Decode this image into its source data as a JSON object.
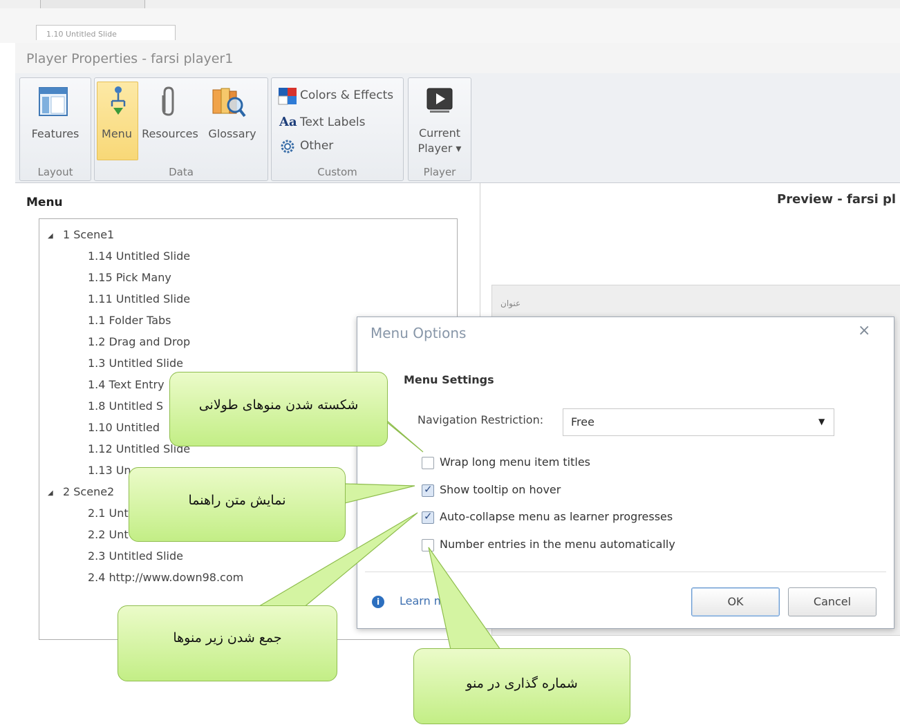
{
  "background": {
    "tab_label": "1.10 Untitled Slide"
  },
  "window": {
    "title": "Player Properties - farsi player1"
  },
  "ribbon": {
    "groups": [
      {
        "caption": "Layout",
        "buttons": [
          {
            "label": "Features",
            "icon": "features-icon"
          }
        ]
      },
      {
        "caption": "Data",
        "buttons": [
          {
            "label": "Menu",
            "icon": "menu-tree-icon",
            "selected": true
          },
          {
            "label": "Resources",
            "icon": "paperclip-icon"
          },
          {
            "label": "Glossary",
            "icon": "glossary-icon"
          }
        ]
      },
      {
        "caption": "Custom",
        "buttons": [
          {
            "label": "Colors & Effects",
            "icon": "color-palette-icon"
          },
          {
            "label": "Text Labels",
            "icon": "text-labels-icon"
          },
          {
            "label": "Other",
            "icon": "gear-icon"
          }
        ]
      },
      {
        "caption": "Player",
        "buttons": [
          {
            "label": "Current Player",
            "label_line1": "Current",
            "label_line2": "Player ▾",
            "icon": "player-icon"
          }
        ]
      }
    ]
  },
  "menu_panel": {
    "heading": "Menu",
    "tree": [
      {
        "label": "1  Scene1",
        "expanded": true,
        "children": [
          "1.14 Untitled Slide",
          "1.15 Pick Many",
          "1.11 Untitled Slide",
          "1.1 Folder Tabs",
          "1.2 Drag and Drop",
          "1.3 Untitled Slide",
          "1.4 Text Entry",
          "1.8 Untitled S",
          "1.10 Untitled",
          "1.12 Untitled Slide",
          "1.13 Un"
        ]
      },
      {
        "label": "2 Scene2",
        "expanded": true,
        "children": [
          "2.1 Unt",
          "2.2 Unt",
          "2.3 Untitled Slide",
          "2.4 http://www.down98.com"
        ]
      }
    ]
  },
  "preview": {
    "title": "Preview - farsi pl",
    "content_text": "عنوان"
  },
  "dialog": {
    "title": "Menu Options",
    "close_glyph": "×",
    "section_title": "Menu Settings",
    "navigation_restriction": {
      "label": "Navigation Restriction:",
      "value": "Free"
    },
    "options": [
      {
        "label": "Wrap long menu item titles",
        "checked": false
      },
      {
        "label": "Show tooltip on hover",
        "checked": true
      },
      {
        "label": "Auto-collapse menu as learner progresses",
        "checked": true
      },
      {
        "label": "Number entries in the menu automatically",
        "checked": false
      }
    ],
    "learn_more": "Learn m...",
    "ok_label": "OK",
    "cancel_label": "Cancel"
  },
  "callouts": {
    "wrap": "شکسته شدن منوهای طولانی",
    "tooltip": "نمایش متن راهنما",
    "collapse": "جمع شدن زیر منوها",
    "number": "شماره گذاری در منو"
  },
  "colors": {
    "callout_fill": "#c3ee86",
    "callout_border": "#8ebd4d",
    "selected_ribbon": "#f8d877",
    "dialog_title": "#8796a8"
  }
}
